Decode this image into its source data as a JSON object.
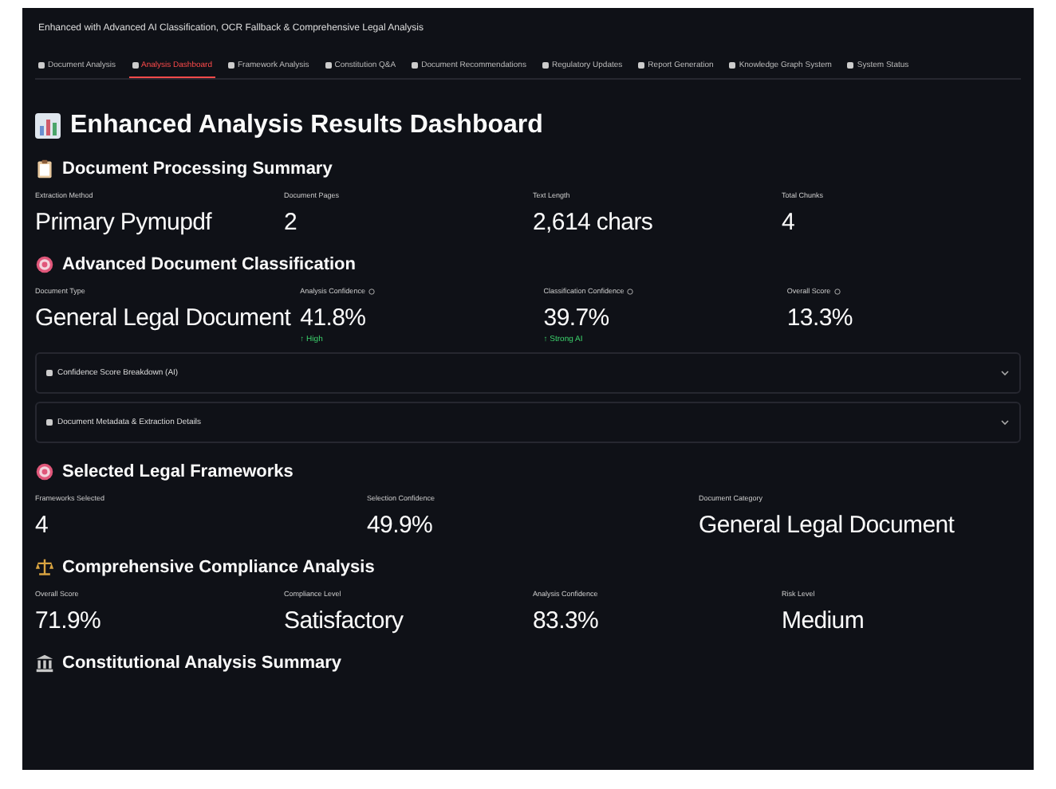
{
  "app_title": "Enhanced with Advanced AI Classification, OCR Fallback & Comprehensive Legal Analysis",
  "tabs": [
    {
      "label": "Document Analysis",
      "selected": false
    },
    {
      "label": "Analysis Dashboard",
      "selected": true
    },
    {
      "label": "Framework Analysis",
      "selected": false
    },
    {
      "label": "Constitution Q&A",
      "selected": false
    },
    {
      "label": "Document Recommendations",
      "selected": false
    },
    {
      "label": "Regulatory Updates",
      "selected": false
    },
    {
      "label": "Report Generation",
      "selected": false
    },
    {
      "label": "Knowledge Graph System",
      "selected": false
    },
    {
      "label": "System Status",
      "selected": false
    }
  ],
  "page_heading": "Enhanced Analysis Results Dashboard",
  "sections": [
    {
      "kind": "metrics",
      "heading": "Document Processing Summary",
      "metrics": [
        {
          "label": "Extraction Method",
          "value": "Primary Pymupdf"
        },
        {
          "label": "Document Pages",
          "value": "2"
        },
        {
          "label": "Text Length",
          "value": "2,614 chars"
        },
        {
          "label": "Total Chunks",
          "value": "4"
        }
      ]
    },
    {
      "kind": "metrics",
      "heading": "Advanced Document Classification",
      "metrics": [
        {
          "label": "Document Type",
          "value": "General Legal Document"
        },
        {
          "label": "Analysis Confidence",
          "help": true,
          "value": "41.8%",
          "delta": "↑ High"
        },
        {
          "label": "Classification Confidence",
          "help": true,
          "value": "39.7%",
          "delta": "↑ Strong AI"
        },
        {
          "label": "Overall Score",
          "help": true,
          "value": "13.3%"
        }
      ],
      "expanders": [
        {
          "label": "Confidence Score Breakdown (AI)",
          "expanded": false
        },
        {
          "label": "Document Metadata & Extraction Details",
          "expanded": false
        }
      ]
    },
    {
      "kind": "metrics",
      "heading": "Selected Legal Frameworks",
      "metrics": [
        {
          "label": "Frameworks Selected",
          "value": "4"
        },
        {
          "label": "Selection Confidence",
          "value": "49.9%"
        },
        {
          "label": "Document Category",
          "value": "General Legal Document"
        }
      ]
    },
    {
      "kind": "metrics",
      "heading": "Comprehensive Compliance Analysis",
      "metrics": [
        {
          "label": "Overall Score",
          "value": "71.9%"
        },
        {
          "label": "Compliance Level",
          "value": "Satisfactory"
        },
        {
          "label": "Analysis Confidence",
          "value": "83.3%"
        },
        {
          "label": "Risk Level",
          "value": "Medium"
        }
      ]
    },
    {
      "kind": "heading",
      "heading": "Constitutional Analysis Summary"
    }
  ]
}
